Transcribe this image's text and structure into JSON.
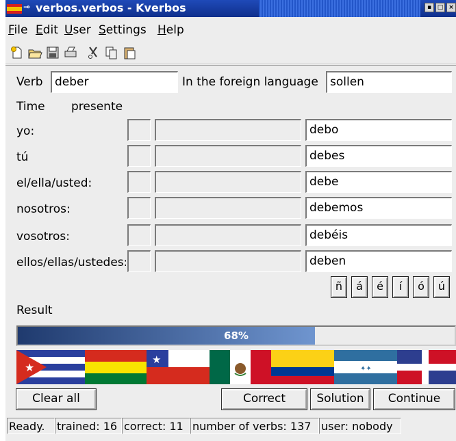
{
  "window": {
    "title": "verbos.verbos - Kverbos"
  },
  "menubar": {
    "items": [
      {
        "label": "File"
      },
      {
        "label": "Edit"
      },
      {
        "label": "User"
      },
      {
        "label": "Settings"
      },
      {
        "label": "Help"
      }
    ]
  },
  "toolbar": {
    "icons": [
      "new-file-icon",
      "open-folder-icon",
      "save-icon",
      "print-icon",
      "cut-icon",
      "copy-icon",
      "paste-icon"
    ]
  },
  "form": {
    "verb_label": "Verb",
    "verb_value": "deber",
    "foreign_label": "In the foreign language",
    "foreign_value": "sollen",
    "time_label": "Time",
    "time_value": "presente"
  },
  "conjugations": [
    {
      "pronoun": "yo:",
      "answer": "debo"
    },
    {
      "pronoun": "tú",
      "answer": "debes"
    },
    {
      "pronoun": "el/ella/usted:",
      "answer": "debe"
    },
    {
      "pronoun": "nosotros:",
      "answer": "debemos"
    },
    {
      "pronoun": "vosotros:",
      "answer": "debéis"
    },
    {
      "pronoun": "ellos/ellas/ustedes:",
      "answer": "deben"
    }
  ],
  "special_chars": [
    "ñ",
    "á",
    "é",
    "í",
    "ó",
    "ú"
  ],
  "result": {
    "label": "Result",
    "progress_text": "68%",
    "progress_value": 0.68
  },
  "buttons": {
    "clear_all": "Clear all",
    "correct": "Correct",
    "solution": "Solution",
    "continue": "Continue"
  },
  "status": {
    "ready": "Ready.",
    "trained": "trained: 16",
    "correct": "correct: 11",
    "verbs": "number of verbs: 137",
    "user": "user: nobody"
  },
  "colors": {
    "titlebar": "#1f4ab8",
    "progress_fill_start": "#1f3a6e",
    "progress_fill_end": "#6f95cf"
  }
}
